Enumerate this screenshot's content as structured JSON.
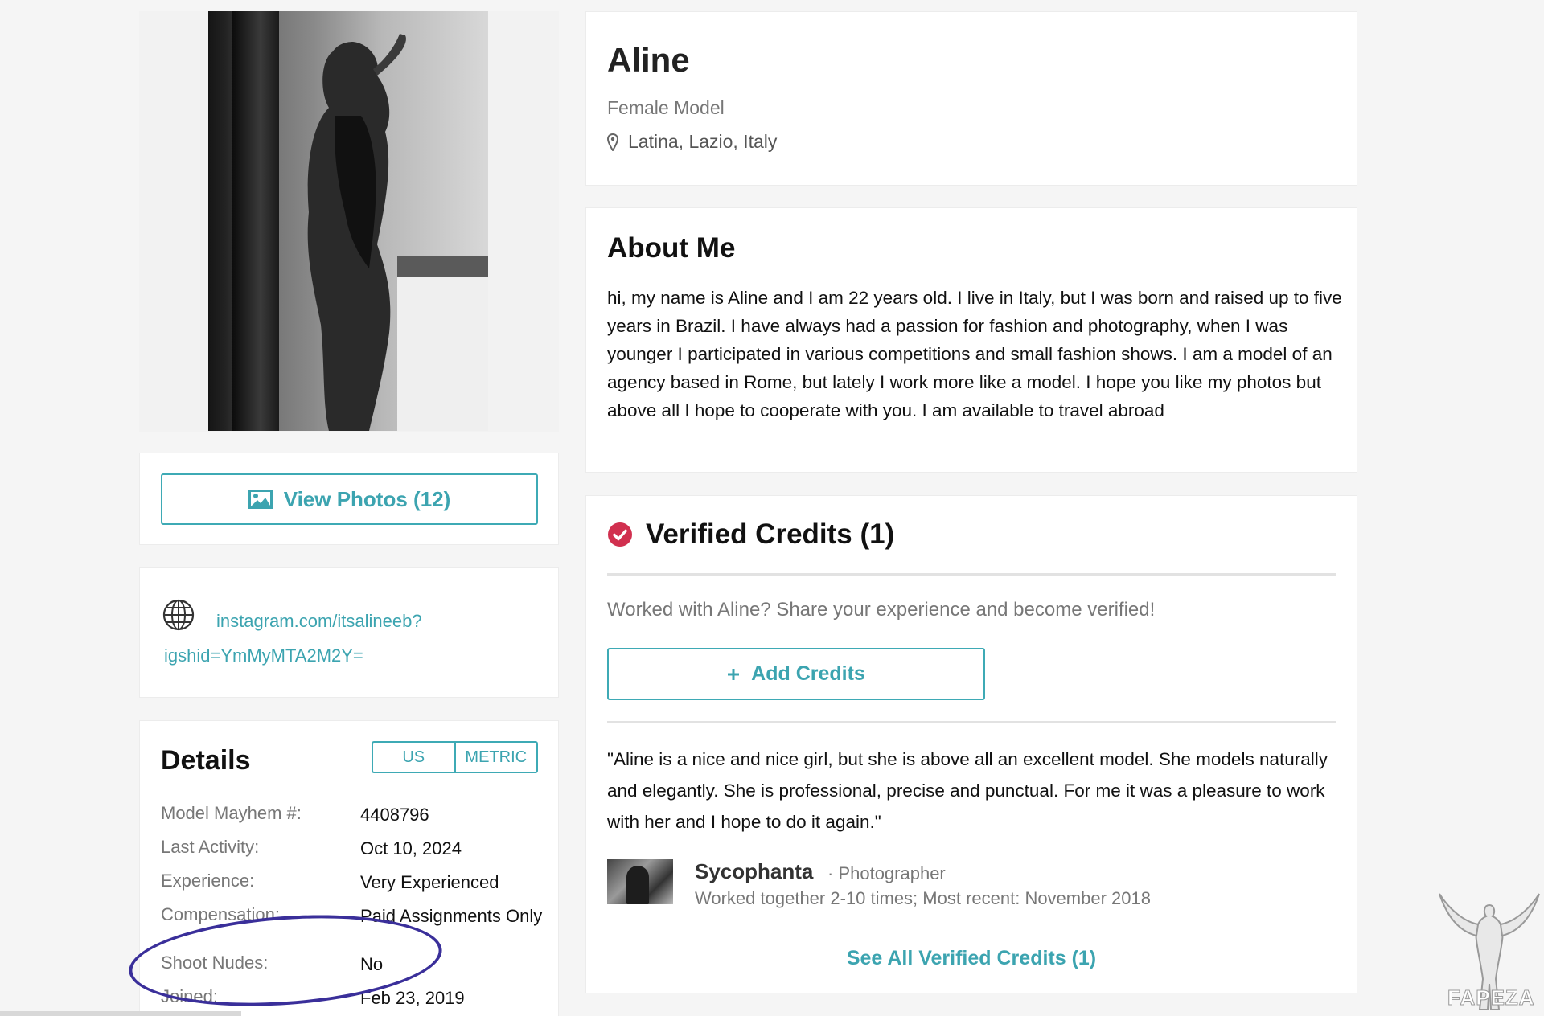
{
  "profile": {
    "name": "Aline",
    "role": "Female Model",
    "location": "Latina, Lazio, Italy"
  },
  "photos": {
    "view_label": "View Photos (12)"
  },
  "links": {
    "instagram_line1": "instagram.com/itsalineeb?",
    "instagram_line2": "igshid=YmMyMTA2M2Y="
  },
  "details": {
    "title": "Details",
    "unit_us": "US",
    "unit_metric": "METRIC",
    "rows": [
      {
        "label": "Model Mayhem #:",
        "value": "4408796"
      },
      {
        "label": "Last Activity:",
        "value": "Oct 10, 2024"
      },
      {
        "label": "Experience:",
        "value": "Very Experienced"
      },
      {
        "label": "Compensation:",
        "value": "Paid Assignments Only"
      },
      {
        "label": "Shoot Nudes:",
        "value": "No"
      },
      {
        "label": "Joined:",
        "value": "Feb 23, 2019"
      }
    ]
  },
  "about": {
    "title": "About Me",
    "text": "hi, my name is Aline and I am 22 years old. I live in Italy, but I was born and raised up to five years in Brazil. I have always had a passion for fashion and photography, when I was younger I participated in various competitions and small fashion shows. I am a model of an agency based in Rome, but lately I work more like a model. I hope you like my photos but above all I hope to cooperate with you. I am available to travel abroad"
  },
  "credits": {
    "title": "Verified Credits (1)",
    "prompt": "Worked with Aline? Share your experience and become verified!",
    "add_label": "Add Credits",
    "quote": "\"Aline is a nice and nice girl, but she is above all an excellent model. She models naturally and elegantly. She is professional, precise and punctual. For me it was a pleasure to work with her and I hope to do it again.\"",
    "reviewer_name": "Sycophanta",
    "reviewer_role": "· Photographer",
    "reviewer_meta": "Worked together 2-10 times; Most recent: November 2018",
    "see_all_label": "See All Verified Credits (1)"
  },
  "watermark": "FAPEZA",
  "colors": {
    "accent": "#3ca4b0",
    "verified": "#d1304f",
    "annotation_circle": "#3a2f9a"
  },
  "icons": [
    "image-icon",
    "globe-icon",
    "map-pin-icon",
    "verified-check-icon",
    "plus-icon"
  ]
}
